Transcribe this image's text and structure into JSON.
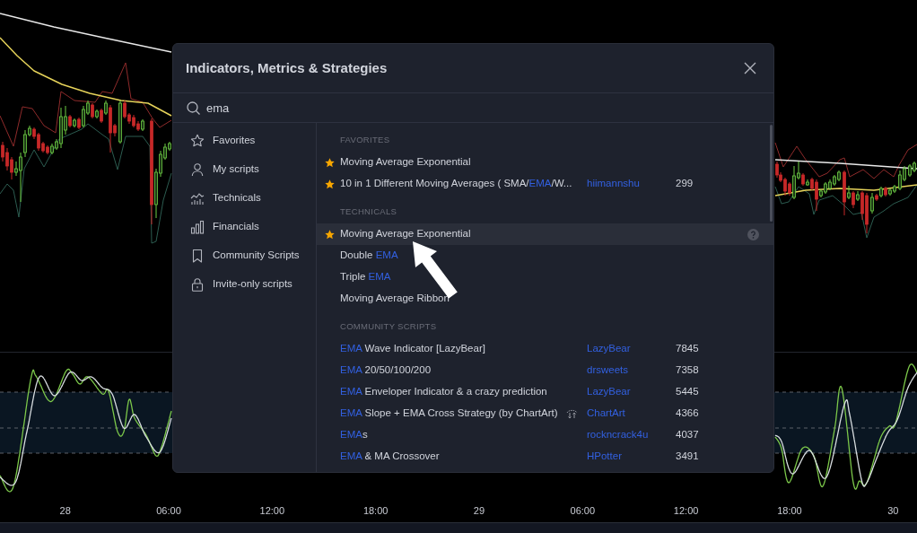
{
  "chart": {
    "time_axis": [
      "28",
      "06:00",
      "12:00",
      "18:00",
      "29",
      "06:00",
      "12:00",
      "18:00",
      "30"
    ]
  },
  "dialog": {
    "title": "Indicators, Metrics & Strategies",
    "search": {
      "value": "ema"
    },
    "sidebar": {
      "items": [
        {
          "label": "Favorites",
          "selected": false
        },
        {
          "label": "My scripts",
          "selected": false
        },
        {
          "label": "Technicals",
          "selected": false
        },
        {
          "label": "Financials",
          "selected": false
        },
        {
          "label": "Community Scripts",
          "selected": false
        },
        {
          "label": "Invite-only scripts",
          "selected": false
        }
      ]
    },
    "sections": [
      {
        "heading": "FAVORITES",
        "items": [
          {
            "title_parts": [
              {
                "text": "Moving Average Exponential",
                "match": false
              }
            ],
            "favorite": true,
            "highlighted": false
          },
          {
            "title_parts": [
              {
                "text": "10 in 1 Different Moving Averages ( SMA/",
                "match": false
              },
              {
                "text": "EMA",
                "match": true
              },
              {
                "text": "/W...",
                "match": false
              }
            ],
            "favorite": true,
            "highlighted": false,
            "author": "hiimannshu",
            "count": "299"
          }
        ]
      },
      {
        "heading": "TECHNICALS",
        "items": [
          {
            "title_parts": [
              {
                "text": "Moving Average Exponential",
                "match": false
              }
            ],
            "favorite": true,
            "highlighted": true
          },
          {
            "title_parts": [
              {
                "text": "Double ",
                "match": false
              },
              {
                "text": "EMA",
                "match": true
              }
            ],
            "favorite": false,
            "highlighted": false
          },
          {
            "title_parts": [
              {
                "text": "Triple ",
                "match": false
              },
              {
                "text": "EMA",
                "match": true
              }
            ],
            "favorite": false,
            "highlighted": false
          },
          {
            "title_parts": [
              {
                "text": "Moving Average Ribbon",
                "match": false
              }
            ],
            "favorite": false,
            "highlighted": false
          }
        ]
      },
      {
        "heading": "COMMUNITY SCRIPTS",
        "items": [
          {
            "title_parts": [
              {
                "text": "EMA",
                "match": true
              },
              {
                "text": " Wave Indicator [LazyBear]",
                "match": false
              }
            ],
            "favorite": false,
            "highlighted": false,
            "strategy": false,
            "author": "LazyBear",
            "count": "7845"
          },
          {
            "title_parts": [
              {
                "text": "EMA",
                "match": true
              },
              {
                "text": " 20/50/100/200",
                "match": false
              }
            ],
            "favorite": false,
            "highlighted": false,
            "strategy": false,
            "author": "drsweets",
            "count": "7358"
          },
          {
            "title_parts": [
              {
                "text": "EMA",
                "match": true
              },
              {
                "text": " Enveloper Indicator & a crazy prediction",
                "match": false
              }
            ],
            "favorite": false,
            "highlighted": false,
            "strategy": false,
            "author": "LazyBear",
            "count": "5445"
          },
          {
            "title_parts": [
              {
                "text": "EMA",
                "match": true
              },
              {
                "text": " Slope + EMA Cross Strategy (by ChartArt)",
                "match": false
              }
            ],
            "favorite": false,
            "highlighted": false,
            "strategy": true,
            "author": "ChartArt",
            "count": "4366"
          },
          {
            "title_parts": [
              {
                "text": "EMA",
                "match": true
              },
              {
                "text": "s",
                "match": false
              }
            ],
            "favorite": false,
            "highlighted": false,
            "strategy": false,
            "author": "rockncrack4u",
            "count": "4037"
          },
          {
            "title_parts": [
              {
                "text": "EMA",
                "match": true
              },
              {
                "text": " & MA Crossover",
                "match": false
              }
            ],
            "favorite": false,
            "highlighted": false,
            "strategy": false,
            "author": "HPotter",
            "count": "3491"
          }
        ]
      }
    ]
  }
}
